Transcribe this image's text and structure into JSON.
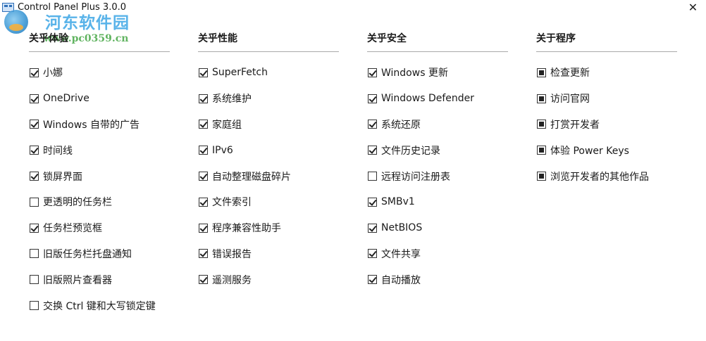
{
  "window": {
    "title": "Control Panel Plus 3.0.0",
    "close_glyph": "✕"
  },
  "watermark": {
    "site_name": "河东软件园",
    "url": "www.pc0359.cn"
  },
  "columns": [
    {
      "heading": "关乎体验",
      "items": [
        {
          "label": "小娜",
          "checked": true
        },
        {
          "label": "OneDrive",
          "checked": true
        },
        {
          "label": "Windows 自带的广告",
          "checked": true
        },
        {
          "label": "时间线",
          "checked": true
        },
        {
          "label": "锁屏界面",
          "checked": true
        },
        {
          "label": "更透明的任务栏",
          "checked": false
        },
        {
          "label": "任务栏预览框",
          "checked": true
        },
        {
          "label": "旧版任务栏托盘通知",
          "checked": false
        },
        {
          "label": "旧版照片查看器",
          "checked": false
        },
        {
          "label": "交换 Ctrl 键和大写锁定键",
          "checked": false
        }
      ]
    },
    {
      "heading": "关乎性能",
      "items": [
        {
          "label": "SuperFetch",
          "checked": true
        },
        {
          "label": "系统维护",
          "checked": true
        },
        {
          "label": "家庭组",
          "checked": true
        },
        {
          "label": "IPv6",
          "checked": true
        },
        {
          "label": "自动整理磁盘碎片",
          "checked": true
        },
        {
          "label": "文件索引",
          "checked": true
        },
        {
          "label": "程序兼容性助手",
          "checked": true
        },
        {
          "label": "错误报告",
          "checked": true
        },
        {
          "label": "遥测服务",
          "checked": true
        }
      ]
    },
    {
      "heading": "关乎安全",
      "items": [
        {
          "label": "Windows 更新",
          "checked": true
        },
        {
          "label": "Windows Defender",
          "checked": true
        },
        {
          "label": "系统还原",
          "checked": true
        },
        {
          "label": "文件历史记录",
          "checked": true
        },
        {
          "label": "远程访问注册表",
          "checked": false
        },
        {
          "label": "SMBv1",
          "checked": true
        },
        {
          "label": "NetBIOS",
          "checked": true
        },
        {
          "label": "文件共享",
          "checked": true
        },
        {
          "label": "自动播放",
          "checked": true
        }
      ]
    },
    {
      "heading": "关于程序",
      "items": [
        {
          "label": "检查更新"
        },
        {
          "label": "访问官网"
        },
        {
          "label": "打赏开发者"
        },
        {
          "label": "体验 Power Keys"
        },
        {
          "label": "浏览开发者的其他作品"
        }
      ]
    }
  ]
}
